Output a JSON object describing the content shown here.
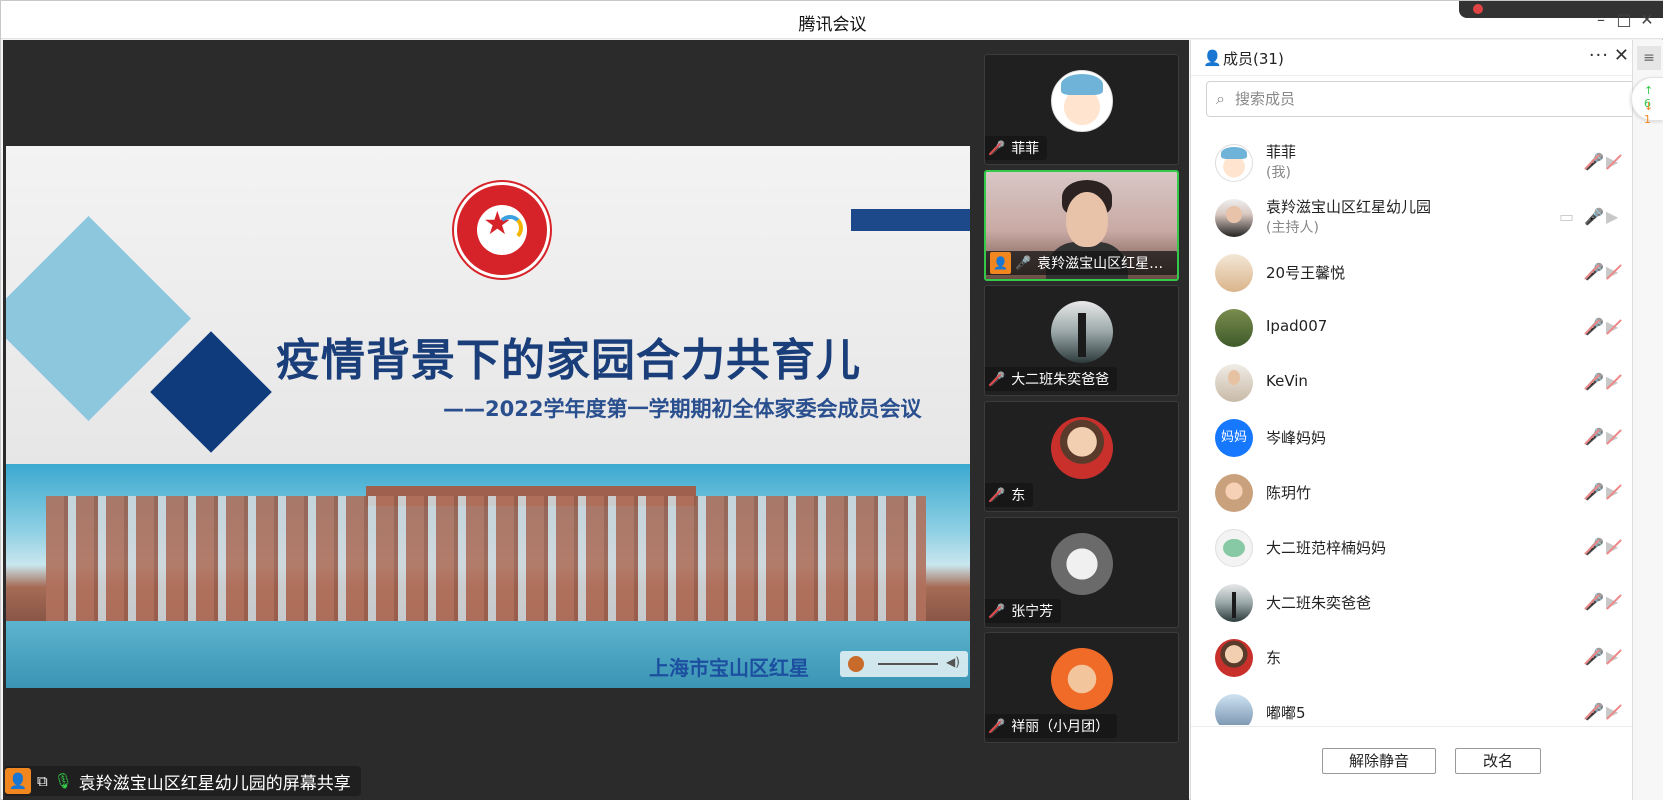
{
  "window": {
    "title": "腾讯会议"
  },
  "slide": {
    "title": "疫情背景下的家园合力共育儿",
    "subtitle": "——2022学年度第一学期期初全体家委会成员会议",
    "footer_text": "上海市宝山区红星"
  },
  "share_label": "袁羚滋宝山区红星幼儿园的屏幕共享",
  "video_tiles": [
    {
      "name": "菲菲",
      "mic": "muted",
      "avatar": "cartoon-girl-icon"
    },
    {
      "name": "袁羚滋宝山区红星幼...",
      "mic": "on",
      "avatar": "camera-video",
      "host": true
    },
    {
      "name": "大二班朱奕爸爸",
      "mic": "muted",
      "avatar": "silhouette-icon"
    },
    {
      "name": "东",
      "mic": "muted",
      "avatar": "boy-photo-icon"
    },
    {
      "name": "张宁芳",
      "mic": "muted",
      "avatar": "round-photo-icon"
    },
    {
      "name": "祥丽（小月团）",
      "mic": "muted",
      "avatar": "orange-photo-icon"
    }
  ],
  "members_panel": {
    "title": "成员(31)",
    "search_placeholder": "搜索成员",
    "members": [
      {
        "name": "菲菲",
        "sub": "(我)",
        "mic": "muted"
      },
      {
        "name": "袁羚滋宝山区红星幼儿园",
        "sub": "(主持人)",
        "mic": "on"
      },
      {
        "name": "20号王馨悦",
        "mic": "muted"
      },
      {
        "name": "Ipad007",
        "mic": "muted"
      },
      {
        "name": "KeVin",
        "mic": "muted"
      },
      {
        "name": "岑峰妈妈",
        "avatar_text": "妈妈",
        "mic": "muted"
      },
      {
        "name": "陈玥竹",
        "mic": "muted"
      },
      {
        "name": "大二班范梓楠妈妈",
        "mic": "muted"
      },
      {
        "name": "大二班朱奕爸爸",
        "mic": "muted"
      },
      {
        "name": "东",
        "mic": "muted"
      },
      {
        "name": "嘟嘟5",
        "mic": "muted"
      }
    ],
    "unmute_label": "解除静音",
    "rename_label": "改名"
  },
  "network": {
    "up": "↑ 6",
    "down": "↓ 1"
  },
  "colors": {
    "accent_green": "#35c94a",
    "host_orange": "#f2861f",
    "slide_blue": "#1a3e7a"
  }
}
